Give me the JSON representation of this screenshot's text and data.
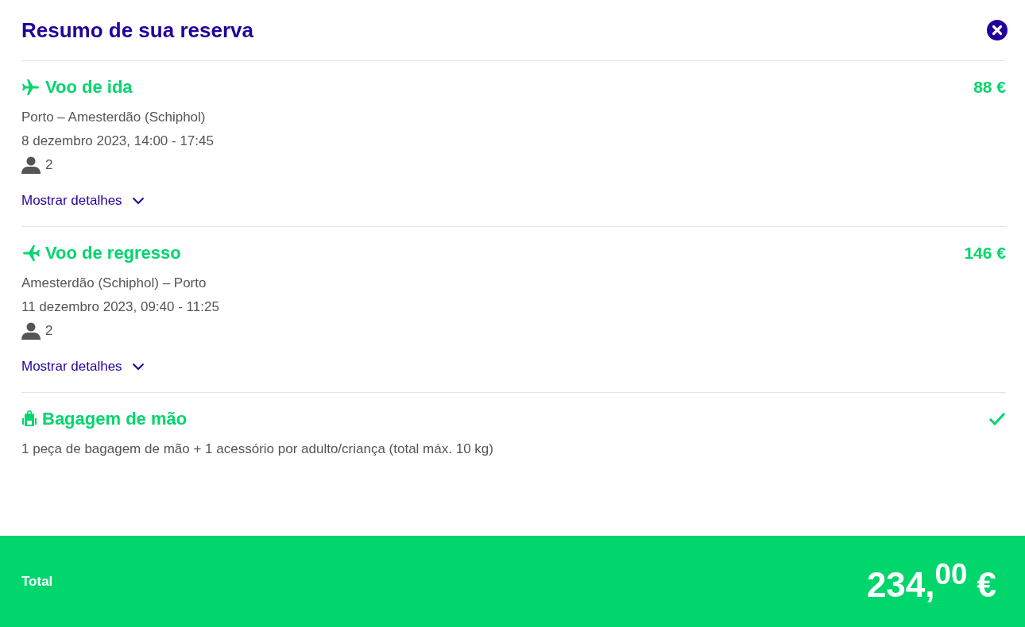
{
  "title": "Resumo de sua reserva",
  "sections": [
    {
      "kind": "outbound",
      "heading": "Voo de ida",
      "price": "88 €",
      "lines": [
        "Porto – Amesterdão (Schiphol)",
        "8 dezembro 2023, 14:00 - 17:45"
      ],
      "passengers": "2",
      "details_link": "Mostrar detalhes"
    },
    {
      "kind": "return",
      "heading": "Voo de regresso",
      "price": "146 €",
      "lines": [
        "Amesterdão (Schiphol) – Porto",
        "11 dezembro 2023, 09:40 - 11:25"
      ],
      "passengers": "2",
      "details_link": "Mostrar detalhes"
    },
    {
      "kind": "baggage",
      "heading": "Bagagem de mão",
      "included": true,
      "lines": [
        "1 peça de bagagem de mão + 1 acessório por adulto/criança (total máx. 10 kg)"
      ]
    }
  ],
  "total": {
    "label": "Total",
    "amount": "234,$^{00}$ €"
  }
}
